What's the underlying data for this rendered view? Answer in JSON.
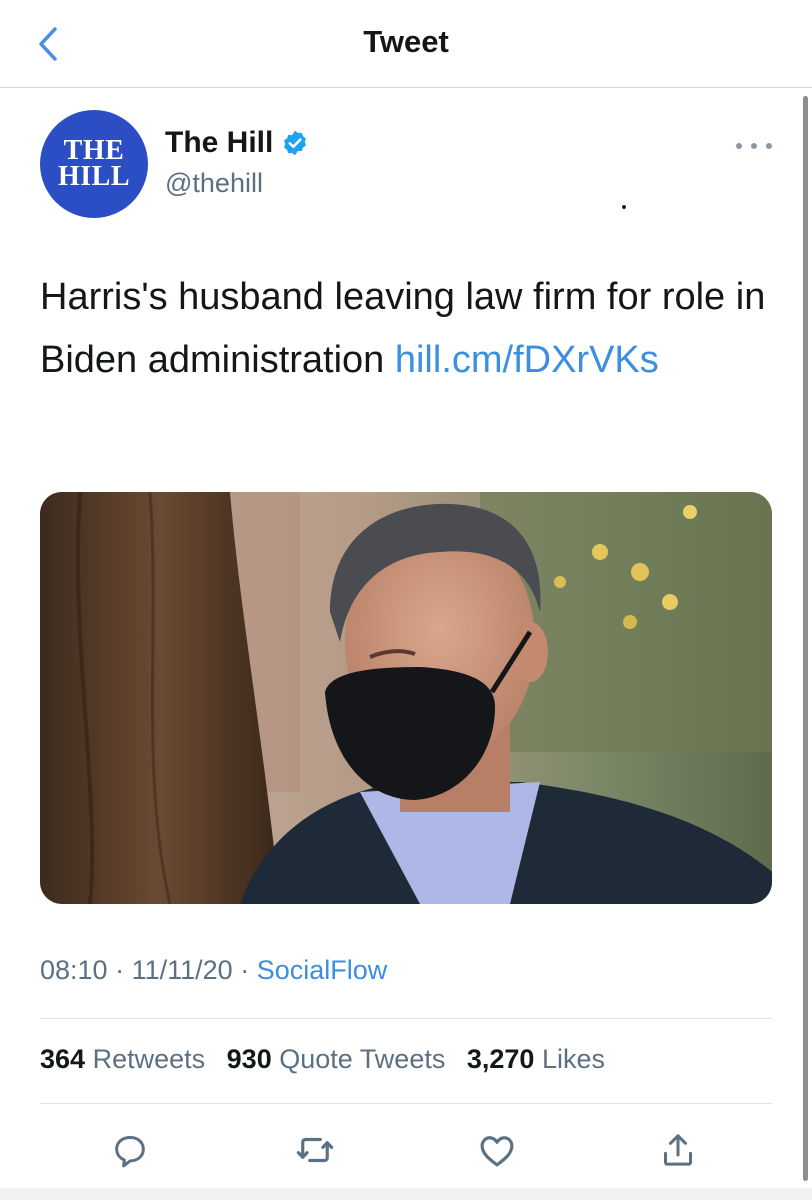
{
  "nav": {
    "title": "Tweet"
  },
  "author": {
    "avatar_line1": "THE",
    "avatar_line2": "HILL",
    "name": "The Hill",
    "handle": "@thehill",
    "verified": true
  },
  "tweet": {
    "text": "Harris's husband leaving law firm for role in Biden administration ",
    "link": "hill.cm/fDXrVKs",
    "time": "08:10",
    "date": "11/11/20",
    "separator": "·",
    "source": "SocialFlow"
  },
  "stats": {
    "retweets_count": "364",
    "retweets_label": "Retweets",
    "quotes_count": "930",
    "quotes_label": "Quote Tweets",
    "likes_count": "3,270",
    "likes_label": "Likes"
  },
  "actions": [
    "reply-icon",
    "retweet-icon",
    "like-icon",
    "share-icon"
  ],
  "colors": {
    "accent": "#1da1f2",
    "link": "#3b8ee0",
    "avatar_bg": "#2c4ec5",
    "muted": "#5b7083"
  }
}
